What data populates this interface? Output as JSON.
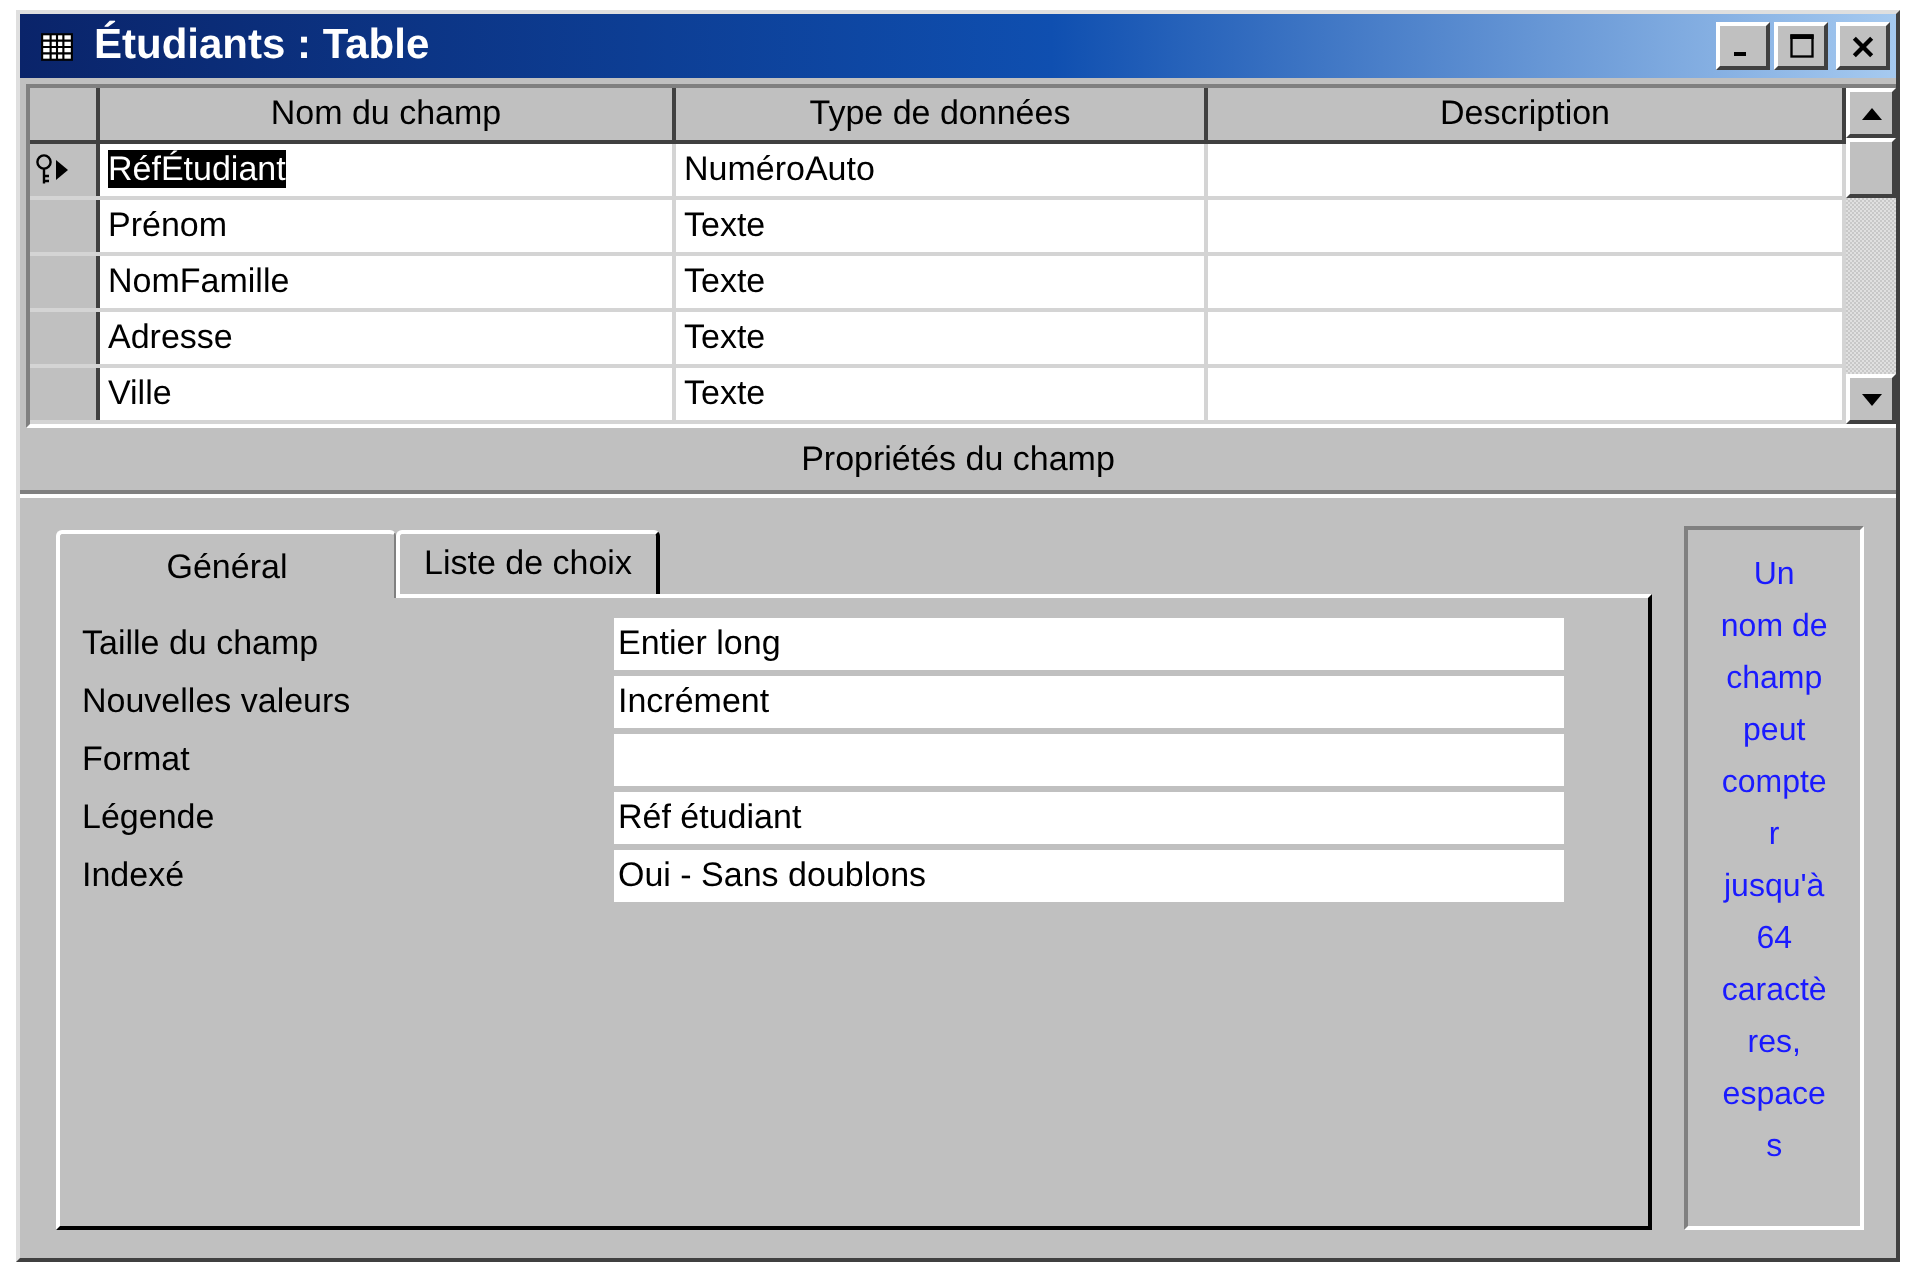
{
  "window": {
    "title": "Étudiants : Table"
  },
  "table": {
    "columns": [
      "Nom du champ",
      "Type de données",
      "Description"
    ],
    "rows": [
      {
        "name": "RéfÉtudiant",
        "type": "NuméroAuto",
        "primary_key": true,
        "current": true,
        "selected": true
      },
      {
        "name": "Prénom",
        "type": "Texte",
        "primary_key": false,
        "current": false,
        "selected": false
      },
      {
        "name": "NomFamille",
        "type": "Texte",
        "primary_key": false,
        "current": false,
        "selected": false
      },
      {
        "name": "Adresse",
        "type": "Texte",
        "primary_key": false,
        "current": false,
        "selected": false
      },
      {
        "name": "Ville",
        "type": "Texte",
        "primary_key": false,
        "current": false,
        "selected": false
      }
    ]
  },
  "properties_title": "Propriétés du champ",
  "tabs": [
    {
      "label": "Général",
      "selected": true
    },
    {
      "label": "Liste de choix",
      "selected": false
    }
  ],
  "properties": [
    {
      "label": "Taille du champ",
      "value": "Entier long"
    },
    {
      "label": "Nouvelles valeurs",
      "value": "Incrément"
    },
    {
      "label": "Format"
    },
    {
      "label": "Légende",
      "value": "Réf étudiant"
    },
    {
      "label": "Indexé",
      "value": "Oui - Sans doublons"
    }
  ],
  "help_text": "Un nom de champ peut compter jusqu'à 64 caractères, espaces"
}
